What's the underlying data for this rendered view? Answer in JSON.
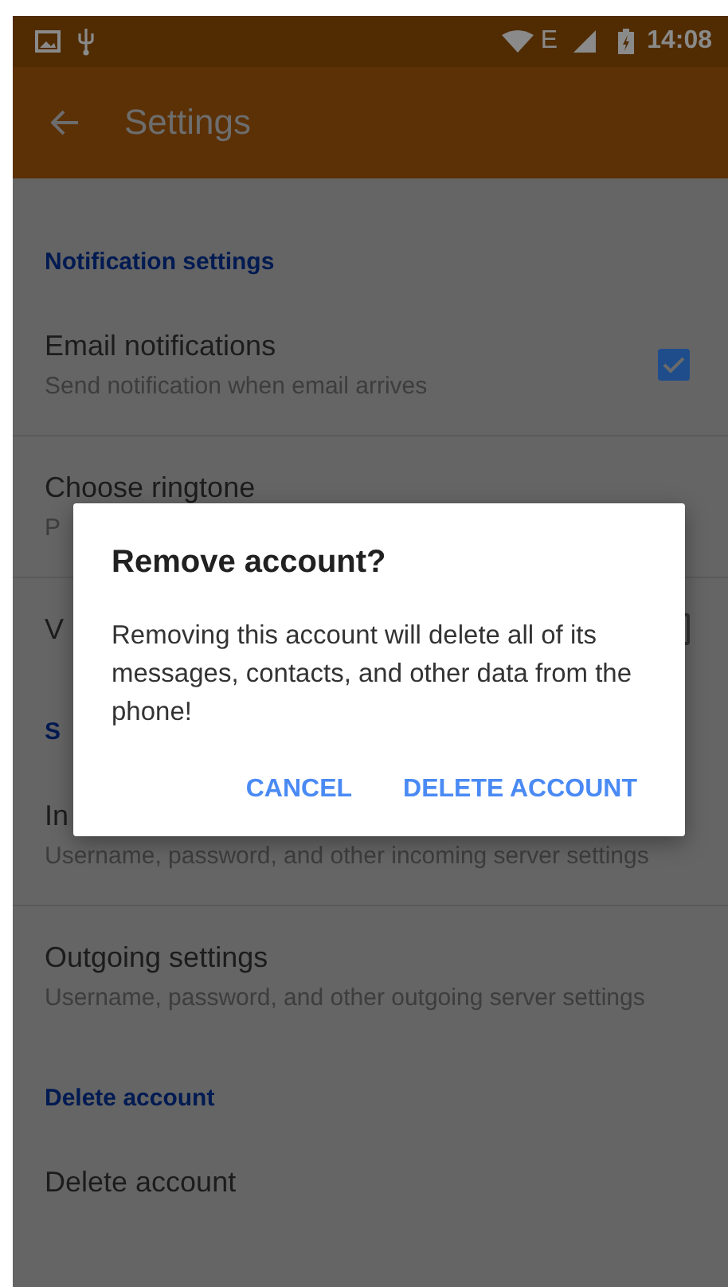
{
  "status_bar": {
    "network": "E",
    "time": "14:08"
  },
  "app_bar": {
    "title": "Settings"
  },
  "settings": [
    {
      "kind": "header",
      "title": "Notification settings"
    },
    {
      "kind": "checkbox",
      "title": "Email notifications",
      "subtitle": "Send notification when email arrives",
      "checked": true
    },
    {
      "kind": "item",
      "title": "Choose ringtone",
      "subtitle": "P"
    },
    {
      "kind": "checkbox",
      "title": "V",
      "checked": false
    },
    {
      "kind": "header",
      "title": "S"
    },
    {
      "kind": "item",
      "title": "In",
      "subtitle": "Username, password, and other incoming server settings"
    },
    {
      "kind": "item",
      "title": "Outgoing settings",
      "subtitle": "Username, password, and other outgoing server settings"
    },
    {
      "kind": "header",
      "title": "Delete account"
    },
    {
      "kind": "item",
      "title": "Delete account"
    }
  ],
  "dialog": {
    "title": "Remove account?",
    "message": "Removing this account will delete all of its messages, contacts, and other data from the phone!",
    "buttons": [
      "CANCEL",
      "DELETE ACCOUNT"
    ]
  }
}
